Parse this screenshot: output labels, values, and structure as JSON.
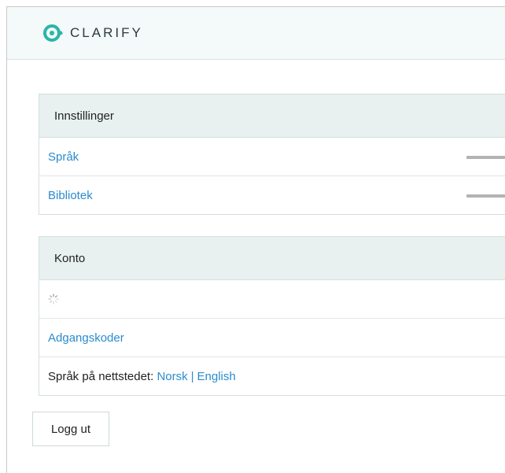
{
  "header": {
    "brand": "CLARIFY",
    "brand_color": "#2bb5a8"
  },
  "settings": {
    "title": "Innstillinger",
    "items": [
      {
        "label": "Språk"
      },
      {
        "label": "Bibliotek"
      }
    ]
  },
  "account": {
    "title": "Konto",
    "loading_icon": "spinner-icon",
    "items": [
      {
        "label": "Adgangskoder"
      }
    ],
    "site_language": {
      "label": "Språk på nettstedet:",
      "options": [
        "Norsk",
        "English"
      ],
      "separator": "|"
    }
  },
  "logout_label": "Logg ut",
  "colors": {
    "link": "#2a8ccc",
    "panel_header": "#e8f0f0",
    "topbar": "#f4f9f9"
  }
}
